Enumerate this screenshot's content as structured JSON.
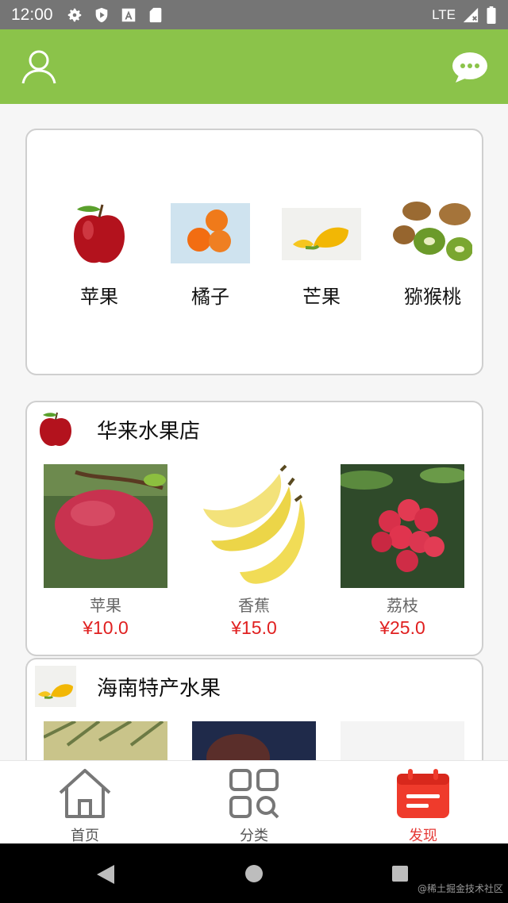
{
  "status_bar": {
    "time": "12:00",
    "network": "LTE",
    "icons": [
      "gear-icon",
      "shield-play-icon",
      "text-a-icon",
      "sd-card-icon",
      "signal-icon",
      "battery-icon"
    ]
  },
  "app_bar": {
    "color": "#8bc34a",
    "left_icon": "user-icon",
    "right_icon": "chat-icon"
  },
  "categories": [
    {
      "name": "苹果",
      "icon": "apple-image"
    },
    {
      "name": "橘子",
      "icon": "orange-image"
    },
    {
      "name": "芒果",
      "icon": "mango-image"
    },
    {
      "name": "猕猴桃",
      "icon": "kiwi-image"
    }
  ],
  "shops": [
    {
      "title": "华来水果店",
      "logo": "apple-image",
      "products": [
        {
          "name": "苹果",
          "price": "¥10.0",
          "image": "apple-photo"
        },
        {
          "name": "香蕉",
          "price": "¥15.0",
          "image": "banana-photo"
        },
        {
          "name": "荔枝",
          "price": "¥25.0",
          "image": "lychee-photo"
        }
      ]
    },
    {
      "title": "海南特产水果",
      "logo": "mango-image",
      "products": [
        {
          "image": "grass-photo"
        },
        {
          "image": "passionfruit-photo"
        },
        {
          "image": "blank-photo"
        }
      ]
    }
  ],
  "bottom_nav": [
    {
      "label": "首页",
      "icon": "home-icon",
      "active": false
    },
    {
      "label": "分类",
      "icon": "grid-search-icon",
      "active": false
    },
    {
      "label": "发现",
      "icon": "calendar-icon",
      "active": true
    }
  ],
  "system_nav": [
    "back-icon",
    "home-circle-icon",
    "recents-icon"
  ],
  "watermark": "@稀土掘金技术社区",
  "colors": {
    "accent": "#8bc34a",
    "price": "#e02020",
    "active_tab": "#e53935"
  }
}
